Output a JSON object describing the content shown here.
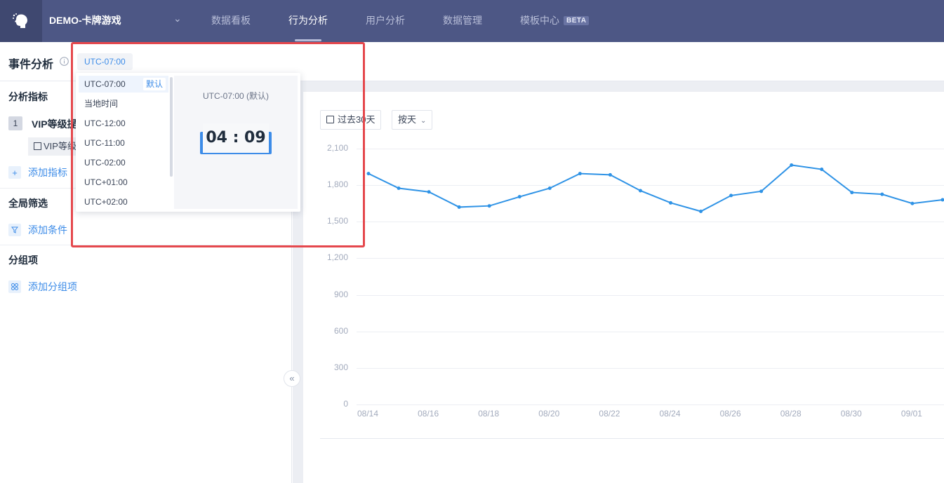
{
  "nav": {
    "project": "DEMO-卡牌游戏",
    "tabs": [
      {
        "label": "数据看板"
      },
      {
        "label": "行为分析"
      },
      {
        "label": "用户分析"
      },
      {
        "label": "数据管理"
      },
      {
        "label": "模板中心"
      }
    ],
    "beta": "BETA"
  },
  "page": {
    "title": "事件分析",
    "timezone": "UTC-07:00"
  },
  "left": {
    "metrics_title": "分析指标",
    "metric_index": "1",
    "metric_name": "VIP等级提",
    "metric_chip": "VIP等级",
    "add_metric": "添加指标",
    "filter_title": "全局筛选",
    "add_condition": "添加条件",
    "group_title": "分组项",
    "add_group": "添加分组项"
  },
  "controls": {
    "date_range": "过去30天",
    "granularity": "按天"
  },
  "dropdown": {
    "items": [
      {
        "label": "UTC-07:00",
        "tag": "默认"
      },
      {
        "label": "当地时间"
      },
      {
        "label": "UTC-12:00"
      },
      {
        "label": "UTC-11:00"
      },
      {
        "label": "UTC-02:00"
      },
      {
        "label": "UTC+01:00"
      },
      {
        "label": "UTC+02:00"
      }
    ],
    "preview_label": "UTC-07:00 (默认)",
    "clock": "04 : 09"
  },
  "colors": {
    "nav_bg": "#4d5785",
    "accent": "#3d8ce8",
    "series": "#2f93e6",
    "highlight": "#e5484d"
  },
  "chart_data": {
    "type": "line",
    "x": [
      "08/14",
      "08/15",
      "08/16",
      "08/17",
      "08/18",
      "08/19",
      "08/20",
      "08/21",
      "08/22",
      "08/23",
      "08/24",
      "08/25",
      "08/26",
      "08/27",
      "08/28",
      "08/29",
      "08/30",
      "08/31",
      "09/01",
      "09/02"
    ],
    "x_tick_labels": [
      "08/14",
      "08/16",
      "08/18",
      "08/20",
      "08/22",
      "08/24",
      "08/26",
      "08/28",
      "08/30",
      "09/01"
    ],
    "series": [
      {
        "values": [
          1895,
          1775,
          1745,
          1620,
          1630,
          1705,
          1775,
          1895,
          1885,
          1755,
          1655,
          1585,
          1715,
          1750,
          1965,
          1930,
          1740,
          1725,
          1650,
          1680
        ]
      }
    ],
    "y_ticks": [
      "0",
      "300",
      "600",
      "900",
      "1,200",
      "1,500",
      "1,800",
      "2,100"
    ],
    "ylim": [
      0,
      2100
    ],
    "grid": true
  }
}
